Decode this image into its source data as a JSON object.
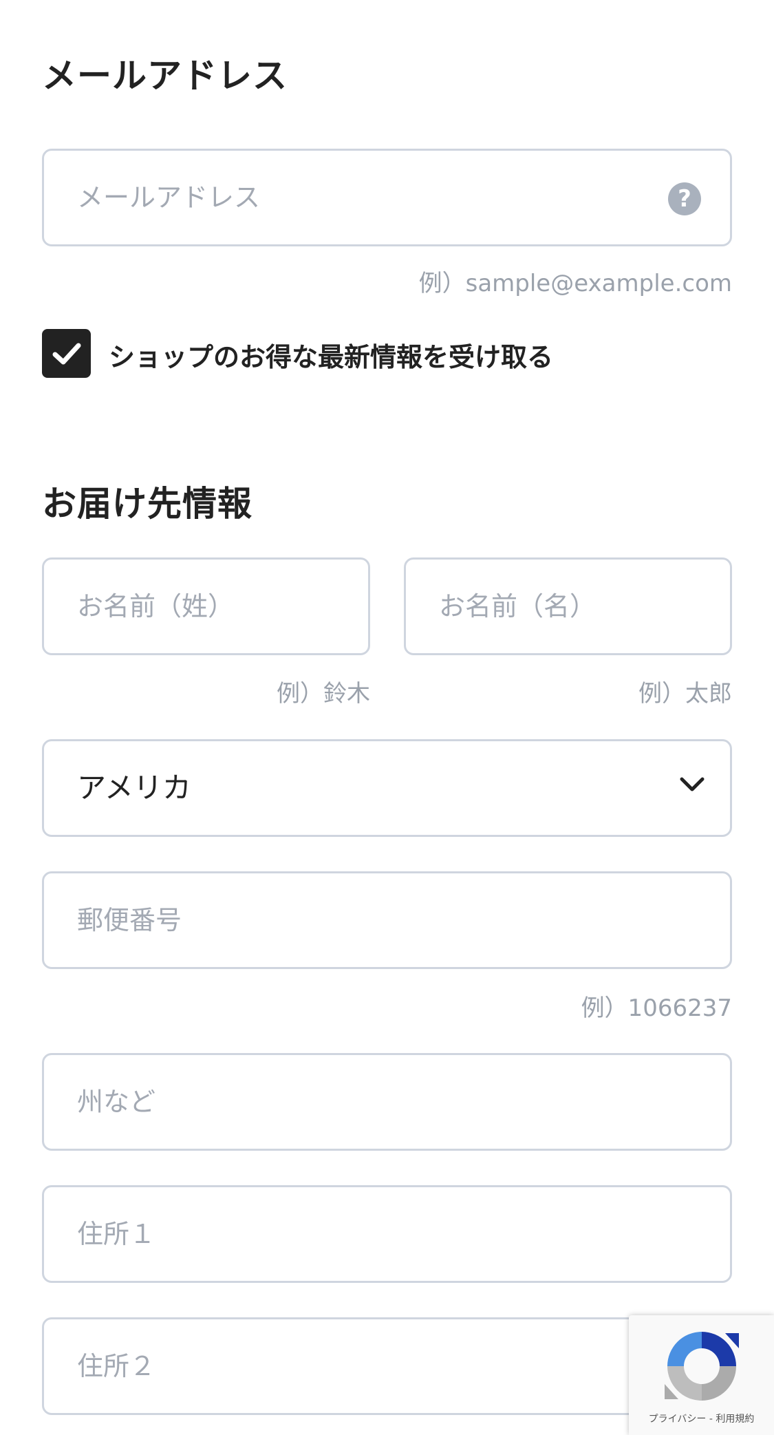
{
  "email_section": {
    "title": "メールアドレス",
    "email_placeholder": "メールアドレス",
    "help_icon": "question-circle-icon",
    "email_hint": "例）sample@example.com",
    "newsletter_checked": true,
    "newsletter_label": "ショップのお得な最新情報を受け取る"
  },
  "shipping_section": {
    "title": "お届け先情報",
    "last_name_placeholder": "お名前（姓）",
    "last_name_hint": "例）鈴木",
    "first_name_placeholder": "お名前（名）",
    "first_name_hint": "例）太郎",
    "country_value": "アメリカ",
    "postal_placeholder": "郵便番号",
    "postal_hint": "例）1066237",
    "state_placeholder": "州など",
    "address1_placeholder": "住所１",
    "address2_placeholder": "住所２"
  },
  "recaptcha": {
    "privacy_label": "プライバシー",
    "separator": "-",
    "terms_label": "利用規約"
  },
  "colors": {
    "border": "#cfd5df",
    "placeholder": "#a3a9b3",
    "text": "#222222",
    "checkbox": "#222222",
    "recaptcha_blue": "#1c3aa9",
    "recaptcha_light_blue": "#4a90e2",
    "recaptcha_gray": "#ababab"
  }
}
